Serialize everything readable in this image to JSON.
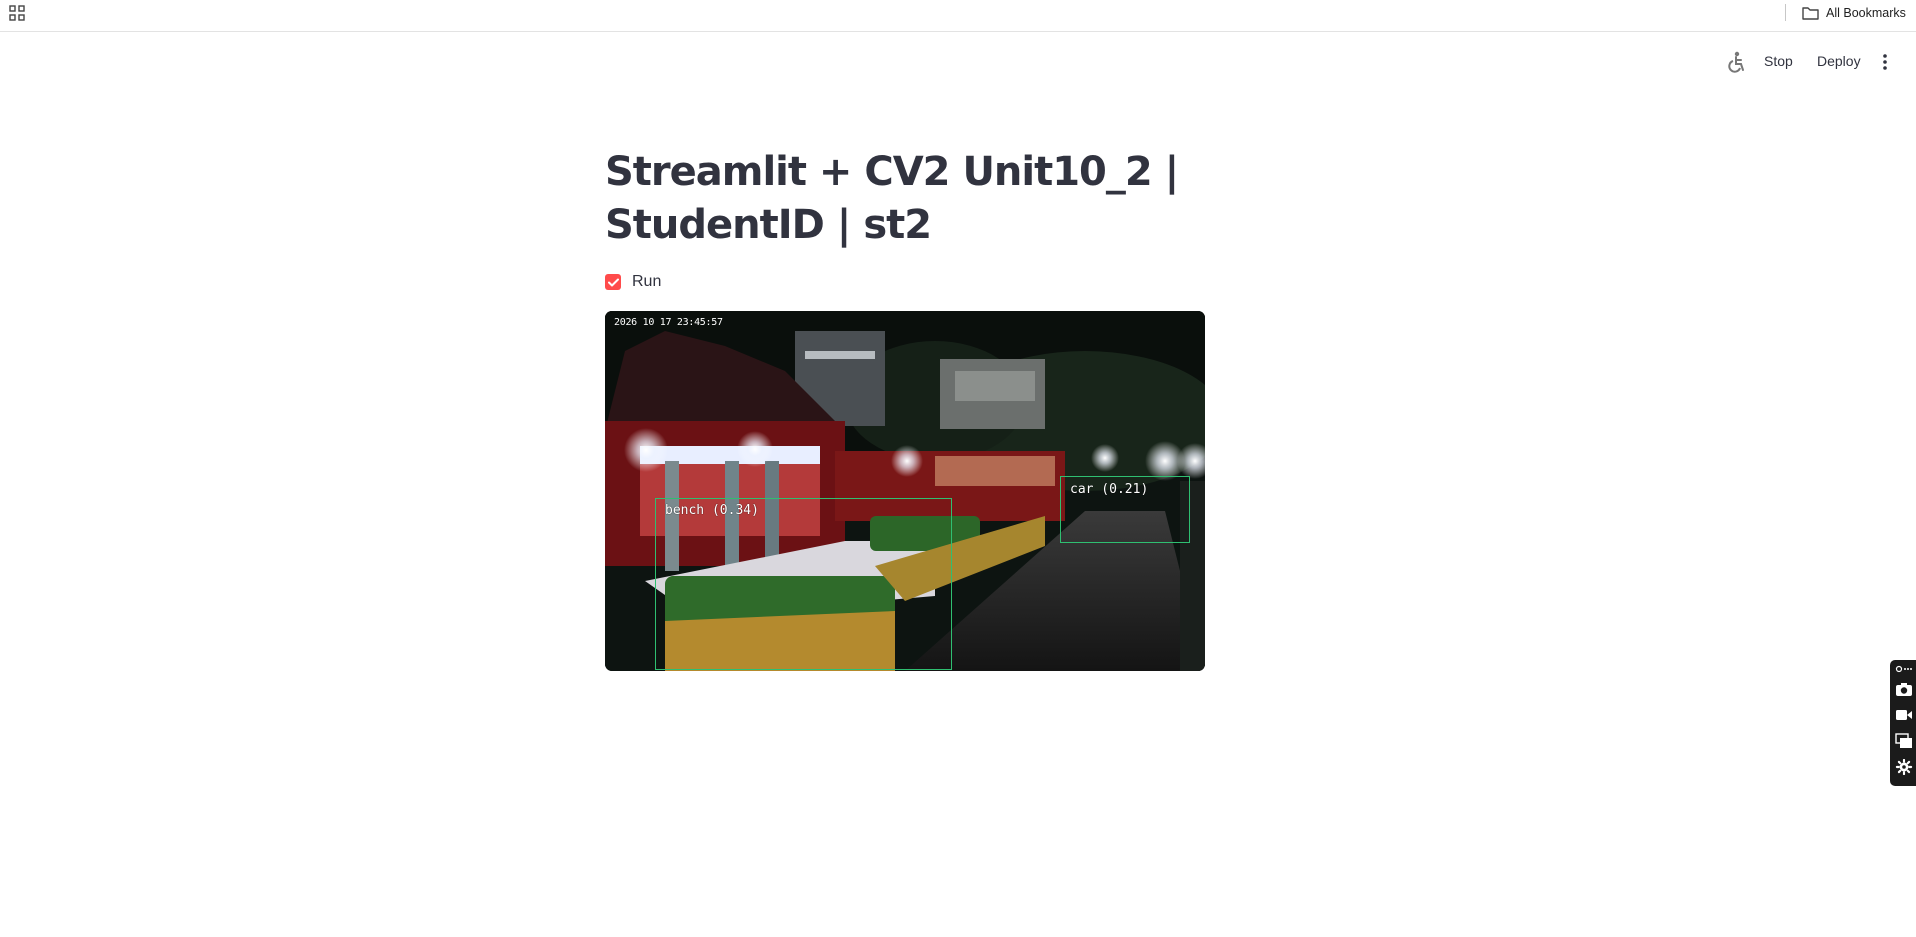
{
  "browser": {
    "all_bookmarks_label": "All Bookmarks"
  },
  "streamlit_header": {
    "stop_label": "Stop",
    "deploy_label": "Deploy"
  },
  "main": {
    "title_line1": "Streamlit + CV2 Unit10_2 |",
    "title_line2": "StudentID | st2",
    "run_checkbox": {
      "label": "Run",
      "checked": true
    }
  },
  "video": {
    "timestamp": "2026 10 17 23:45:57",
    "detections": [
      {
        "label": "bench (0.34)"
      },
      {
        "label": "car (0.21)"
      }
    ]
  },
  "colors": {
    "accent": "#ff4b4b",
    "text": "#31333F",
    "detection_box": "#2fbf71"
  },
  "icons": [
    "apps-grid-icon",
    "folder-icon",
    "wheelchair-icon",
    "more-vertical-icon",
    "camera-icon",
    "video-icon",
    "screens-icon",
    "gear-icon"
  ]
}
